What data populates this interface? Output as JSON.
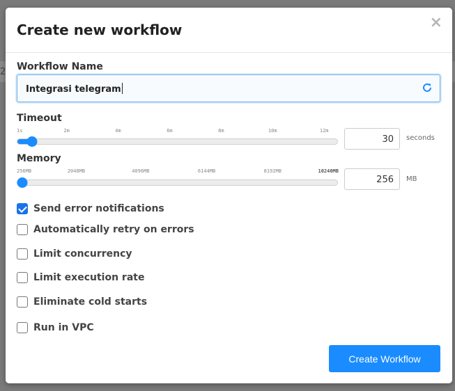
{
  "backdrop": {
    "char": "2"
  },
  "dialog": {
    "title": "Create new workflow",
    "close_glyph": "×"
  },
  "workflow_name": {
    "label": "Workflow Name",
    "value": "Integrasi telegram",
    "icon": "refresh-icon"
  },
  "timeout": {
    "label": "Timeout",
    "ticks": [
      "1s",
      "2m",
      "4m",
      "6m",
      "8m",
      "10m",
      "12m"
    ],
    "value": "30",
    "unit": "seconds",
    "fraction": 0.045
  },
  "memory": {
    "label": "Memory",
    "ticks": [
      "256MB",
      "2048MB",
      "4096MB",
      "6144MB",
      "8192MB",
      "10240MB"
    ],
    "value": "256",
    "unit": "MB",
    "fraction": 0.0
  },
  "options": [
    {
      "label": "Send error notifications",
      "checked": true
    },
    {
      "label": "Automatically retry on errors",
      "checked": false
    },
    {
      "label": "Limit concurrency",
      "checked": false
    },
    {
      "label": "Limit execution rate",
      "checked": false
    },
    {
      "label": "Eliminate cold starts",
      "checked": false
    },
    {
      "label": "Run in VPC",
      "checked": false
    }
  ],
  "submit": {
    "label": "Create Workflow"
  },
  "colors": {
    "accent": "#1a8cff",
    "checkbox": "#1a73e8",
    "focus": "#66afe9"
  }
}
